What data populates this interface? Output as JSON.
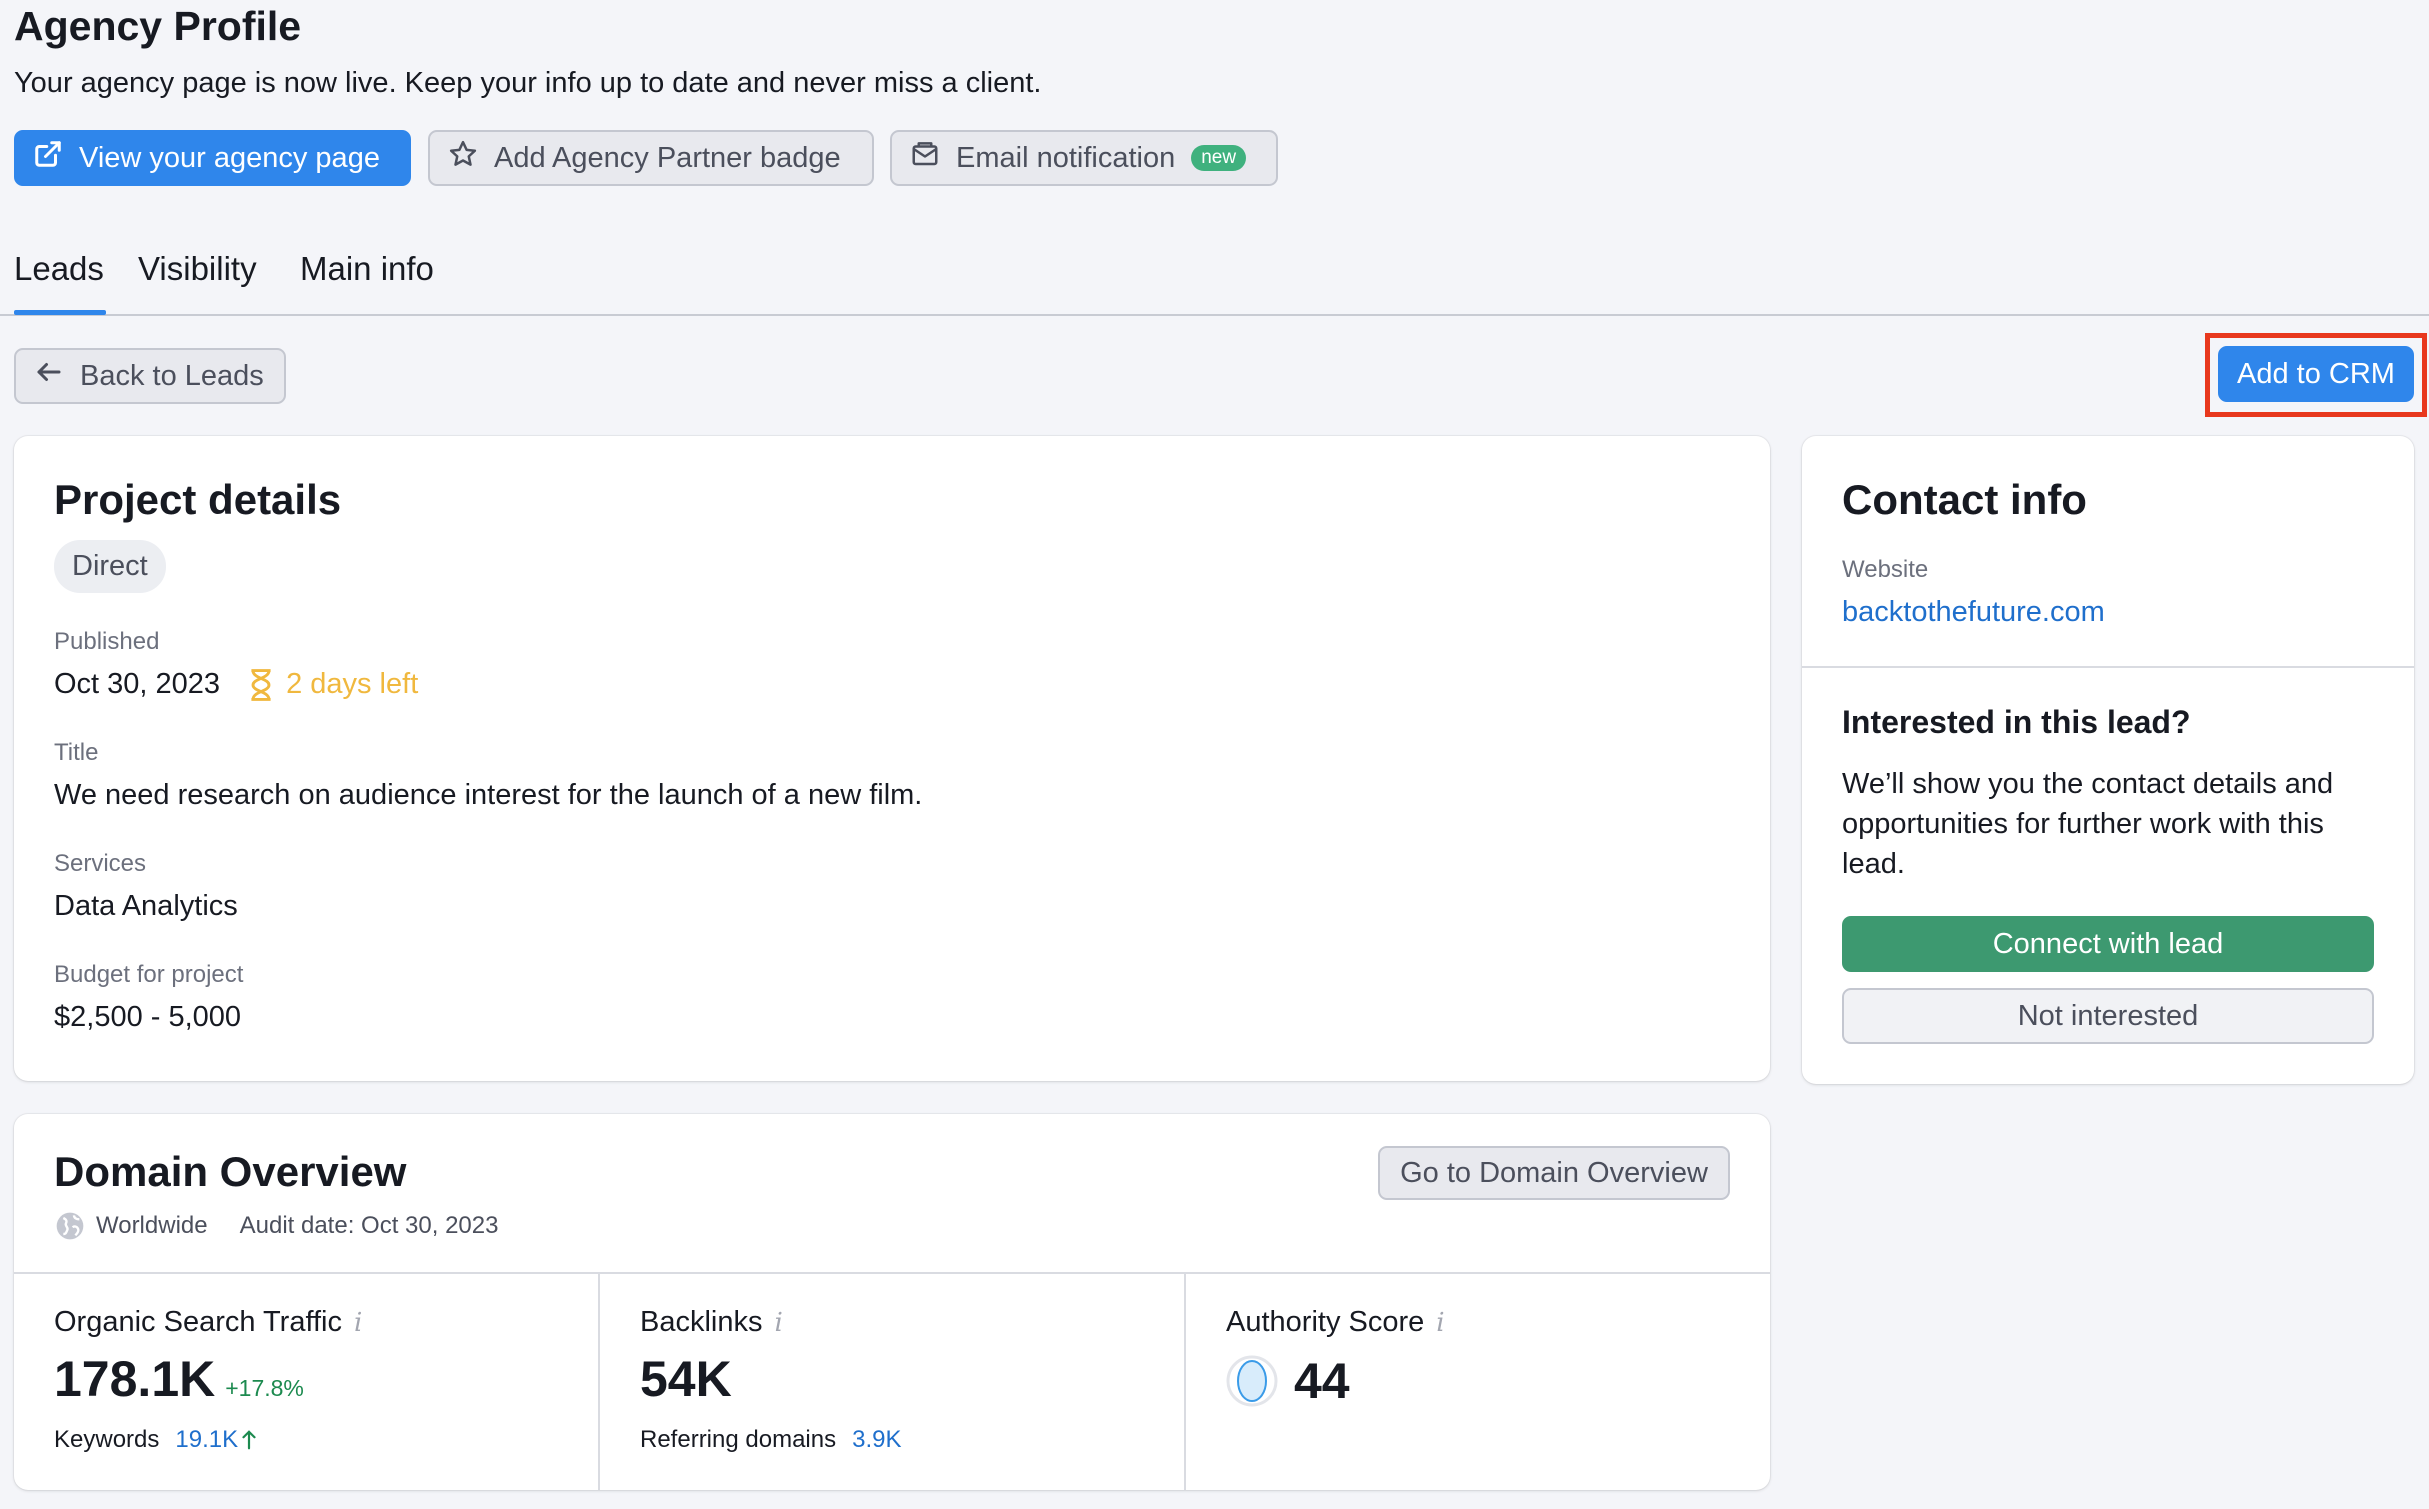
{
  "header": {
    "title": "Agency Profile",
    "subtitle": "Your agency page is now live. Keep your info up to date and never miss a client.",
    "actions": {
      "view_page": "View your agency page",
      "add_badge": "Add Agency Partner badge",
      "email_notification": "Email notification",
      "new_badge": "new"
    }
  },
  "tabs": [
    {
      "label": "Leads",
      "active": true
    },
    {
      "label": "Visibility",
      "active": false
    },
    {
      "label": "Main info",
      "active": false
    }
  ],
  "toolbar": {
    "back_label": "Back to Leads",
    "add_crm_label": "Add to CRM"
  },
  "project": {
    "title": "Project details",
    "type_chip": "Direct",
    "published_label": "Published",
    "published_value": "Oct 30, 2023",
    "days_left": "2 days left",
    "title_label": "Title",
    "title_value": "We need research on audience interest for the launch of a new film.",
    "services_label": "Services",
    "services_value": "Data Analytics",
    "budget_label": "Budget for project",
    "budget_value": "$2,500 - 5,000"
  },
  "contact": {
    "title": "Contact info",
    "website_label": "Website",
    "website_value": "backtothefuture.com",
    "interested_title": "Interested in this lead?",
    "interested_text": "We’ll show you the contact details and opportunities for further work with this lead.",
    "connect_label": "Connect with lead",
    "not_interested_label": "Not interested"
  },
  "domain": {
    "title": "Domain Overview",
    "region": "Worldwide",
    "audit_date": "Audit date: Oct 30, 2023",
    "go_button": "Go to Domain Overview",
    "metrics": {
      "organic": {
        "label": "Organic Search Traffic",
        "value": "178.1K",
        "change": "+17.8%",
        "sub_label": "Keywords",
        "sub_value": "19.1K"
      },
      "backlinks": {
        "label": "Backlinks",
        "value": "54K",
        "sub_label": "Referring domains",
        "sub_value": "3.9K"
      },
      "authority": {
        "label": "Authority Score",
        "value": "44"
      }
    }
  },
  "colors": {
    "primary": "#2f86eb",
    "success": "#3d9970",
    "warning": "#f0b83e",
    "highlight": "#e8381e"
  }
}
